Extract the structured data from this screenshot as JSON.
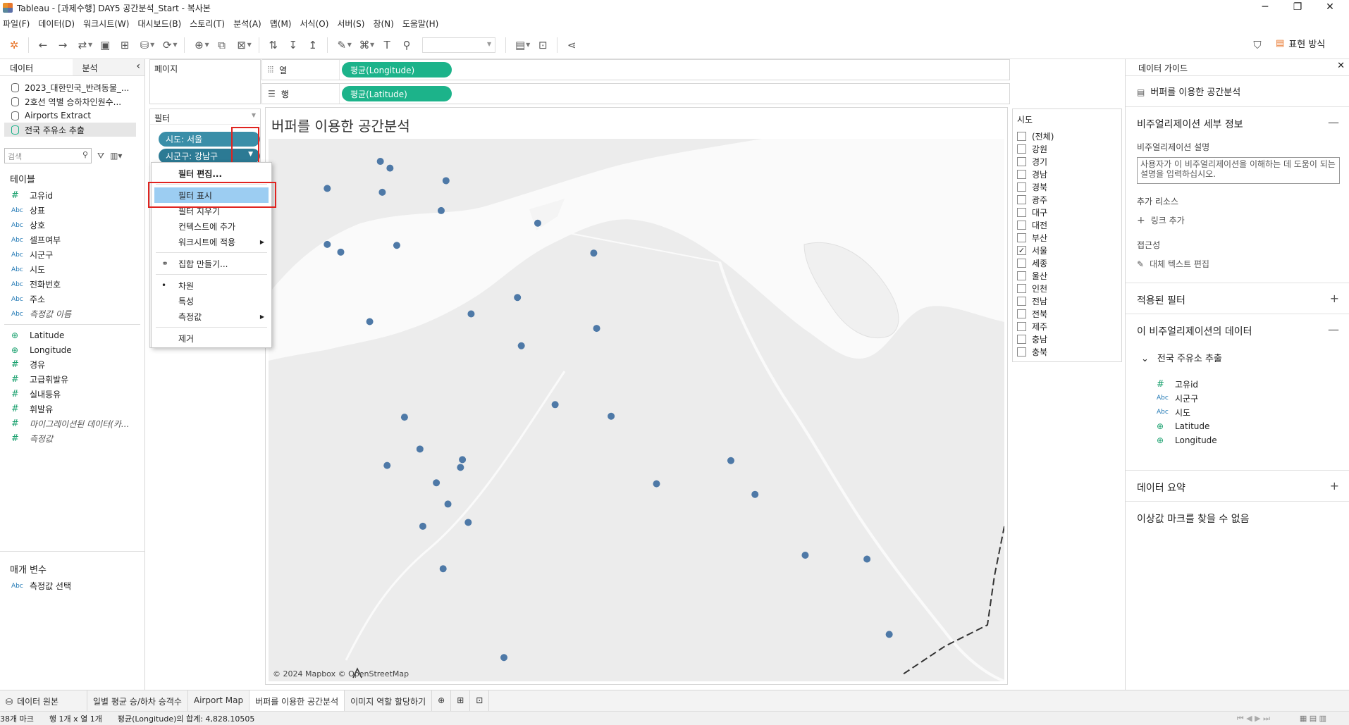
{
  "window": {
    "title": "Tableau - [과제수행] DAY5 공간분석_Start - 복사본",
    "min": "─",
    "max": "❐",
    "close": "✕"
  },
  "menu": [
    "파일(F)",
    "데이터(D)",
    "워크시트(W)",
    "대시보드(B)",
    "스토리(T)",
    "분석(A)",
    "맵(M)",
    "서식(O)",
    "서버(S)",
    "창(N)",
    "도움말(H)"
  ],
  "toolbar": {
    "show_me": "표현 방식"
  },
  "left": {
    "tab_data": "데이터",
    "tab_analysis": "분석",
    "collapse": "‹",
    "datasources": [
      "2023_대한민국_반려동물_...",
      "2호선 역별 승하차인원수...",
      "Airports Extract",
      "전국 주유소 추출"
    ],
    "search_placeholder": "검색",
    "tables_label": "테이블",
    "fields": [
      {
        "type": "#",
        "name": "고유id"
      },
      {
        "type": "Abc",
        "name": "상표"
      },
      {
        "type": "Abc",
        "name": "상호"
      },
      {
        "type": "Abc",
        "name": "셀프여부"
      },
      {
        "type": "Abc",
        "name": "시군구"
      },
      {
        "type": "Abc",
        "name": "시도"
      },
      {
        "type": "Abc",
        "name": "전화번호"
      },
      {
        "type": "Abc",
        "name": "주소"
      },
      {
        "type": "Abc",
        "name": "측정값 이름"
      },
      {
        "type": "⊕",
        "name": "Latitude"
      },
      {
        "type": "⊕",
        "name": "Longitude"
      },
      {
        "type": "#",
        "name": "경유"
      },
      {
        "type": "#",
        "name": "고급휘발유"
      },
      {
        "type": "#",
        "name": "실내등유"
      },
      {
        "type": "#",
        "name": "휘발유"
      },
      {
        "type": "#",
        "name": "마이그레이션된 데이터(카..."
      },
      {
        "type": "#",
        "name": "측정값"
      }
    ],
    "params_label": "매개 변수",
    "param": {
      "type": "Abc",
      "name": "측정값 선택"
    }
  },
  "cards": {
    "pages": "페이지",
    "filters": "필터",
    "filter_pills": [
      "시도: 서울",
      "시군구: 강남구"
    ],
    "columns_label": "열",
    "rows_label": "행",
    "col_pill": "평균(Longitude)",
    "row_pill": "평균(Latitude)"
  },
  "context_menu": {
    "items": [
      "필터 편집...",
      "필터 표시",
      "필터 지우기",
      "컨텍스트에 추가",
      "워크시트에 적용",
      "집합 만들기...",
      "차원",
      "특성",
      "측정값",
      "제거"
    ]
  },
  "view": {
    "title": "버퍼를 이용한 공간분석",
    "attribution": "© 2024 Mapbox © OpenStreetMap",
    "points_color": "#4e79a7"
  },
  "legend": {
    "title": "시도",
    "items": [
      "(전체)",
      "강원",
      "경기",
      "경남",
      "경북",
      "광주",
      "대구",
      "대전",
      "부산",
      "서울",
      "세종",
      "울산",
      "인천",
      "전남",
      "전북",
      "제주",
      "충남",
      "충북"
    ],
    "checked": "서울"
  },
  "guide": {
    "title": "데이터 가이드",
    "sheet": "버퍼를 이용한 공간분석",
    "viz_details": "비주얼리제이션 세부 정보",
    "desc_label": "비주얼리제이션 설명",
    "desc_placeholder": "사용자가 이 비주얼리제이션을 이해하는 데 도움이 되는 설명을 입력하십시오.",
    "resources_label": "추가 리소스",
    "add_link": "링크 추가",
    "access_label": "접근성",
    "alt_text": "대체 텍스트 편집",
    "applied_filters": "적용된 필터",
    "viz_data": "이 비주얼리제이션의 데이터",
    "source": "전국 주유소 추출",
    "fields": [
      {
        "type": "#",
        "name": "고유id"
      },
      {
        "type": "Abc",
        "name": "시군구"
      },
      {
        "type": "Abc",
        "name": "시도"
      },
      {
        "type": "⊕",
        "name": "Latitude"
      },
      {
        "type": "⊕",
        "name": "Longitude"
      }
    ],
    "summary": "데이터 요약",
    "outliers": "이상값 마크를 찾을 수 없음"
  },
  "sheet_tabs": [
    "데이터 원본",
    "일별 평균 승/하차 승객수",
    "Airport Map",
    "버퍼를 이용한 공간분석",
    "이미지 역할 할당하기"
  ],
  "status": {
    "marks": "38개 마크",
    "rows_cols": "행 1개 x 열 1개",
    "sum": "평균(Longitude)의 합계: 4,828.10505"
  }
}
